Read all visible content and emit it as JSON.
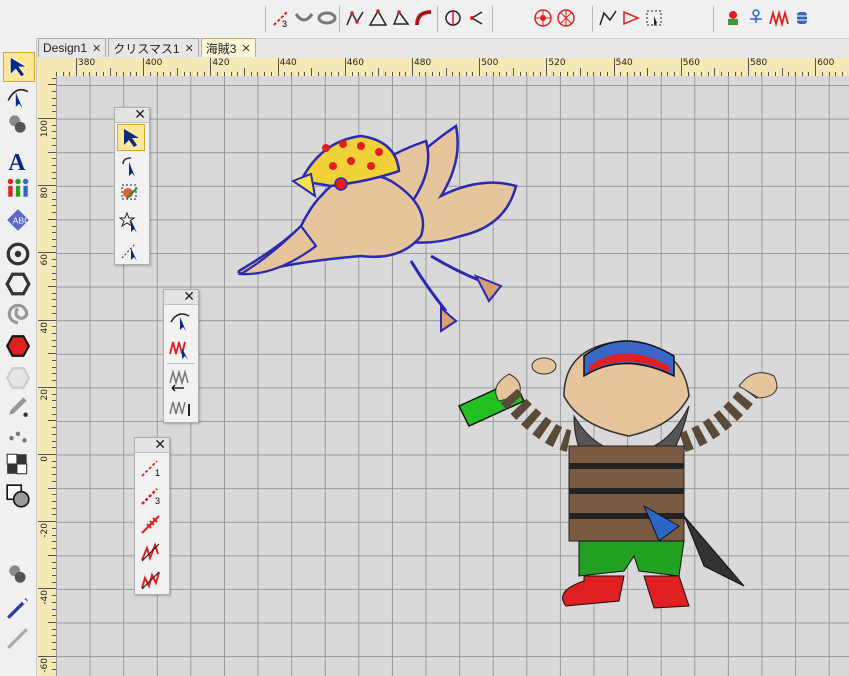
{
  "toolbar": {
    "tools": [
      {
        "name": "run-3-stitch-tool-icon"
      },
      {
        "name": "arc-tool-icon"
      },
      {
        "name": "ring-tool-icon"
      },
      {
        "name": "polyline-tool-icon"
      },
      {
        "name": "polygon-tool-icon"
      },
      {
        "name": "closed-curve-tool-icon"
      },
      {
        "name": "satin-curve-tool-icon"
      },
      {
        "name": "center-point-tool-icon"
      },
      {
        "name": "open-shape-tool-icon"
      },
      {
        "name": "radial-fill-tool-icon"
      },
      {
        "name": "star-fill-tool-icon"
      },
      {
        "name": "line-run-tool-icon"
      },
      {
        "name": "arrow-tool-icon"
      },
      {
        "name": "select-points-tool-icon"
      },
      {
        "name": "applique-tool-icon"
      },
      {
        "name": "stitch-figure-tool-icon"
      },
      {
        "name": "zigzag-tool-icon"
      },
      {
        "name": "bobbin-tool-icon"
      }
    ]
  },
  "tabs": [
    {
      "label": "Design1",
      "active": false
    },
    {
      "label": "クリスマス1",
      "active": false
    },
    {
      "label": "海賊3",
      "active": true
    }
  ],
  "ruler": {
    "h_labels": [
      "380",
      "400",
      "420",
      "440",
      "460",
      "480",
      "500",
      "520",
      "540",
      "560",
      "580",
      "600"
    ],
    "v_labels": [
      "100",
      "80",
      "60",
      "40",
      "20",
      "0",
      "-20",
      "-40",
      "-60"
    ]
  },
  "colors": {
    "accent": "#ffe79a",
    "canvas": "#d9d9d9",
    "ruler": "#f6e9b8",
    "thread_navy": "#2a2ab0",
    "thread_tan": "#e6c49c",
    "thread_red": "#e02020",
    "thread_green": "#22c022"
  },
  "panels": {
    "select": {
      "tools": [
        "select-arrow-icon",
        "select-rotate-icon",
        "select-color-icon",
        "select-magic-icon",
        "select-line-icon"
      ]
    },
    "edit": {
      "tools": [
        "edit-node-icon",
        "edit-stitch-icon",
        "stitch-insert-icon",
        "stitch-add-icon"
      ]
    },
    "run": {
      "tools": [
        "run-single-icon",
        "run-triple-icon",
        "run-motif-icon",
        "run-satin-icon",
        "run-zigzag-icon"
      ]
    }
  }
}
